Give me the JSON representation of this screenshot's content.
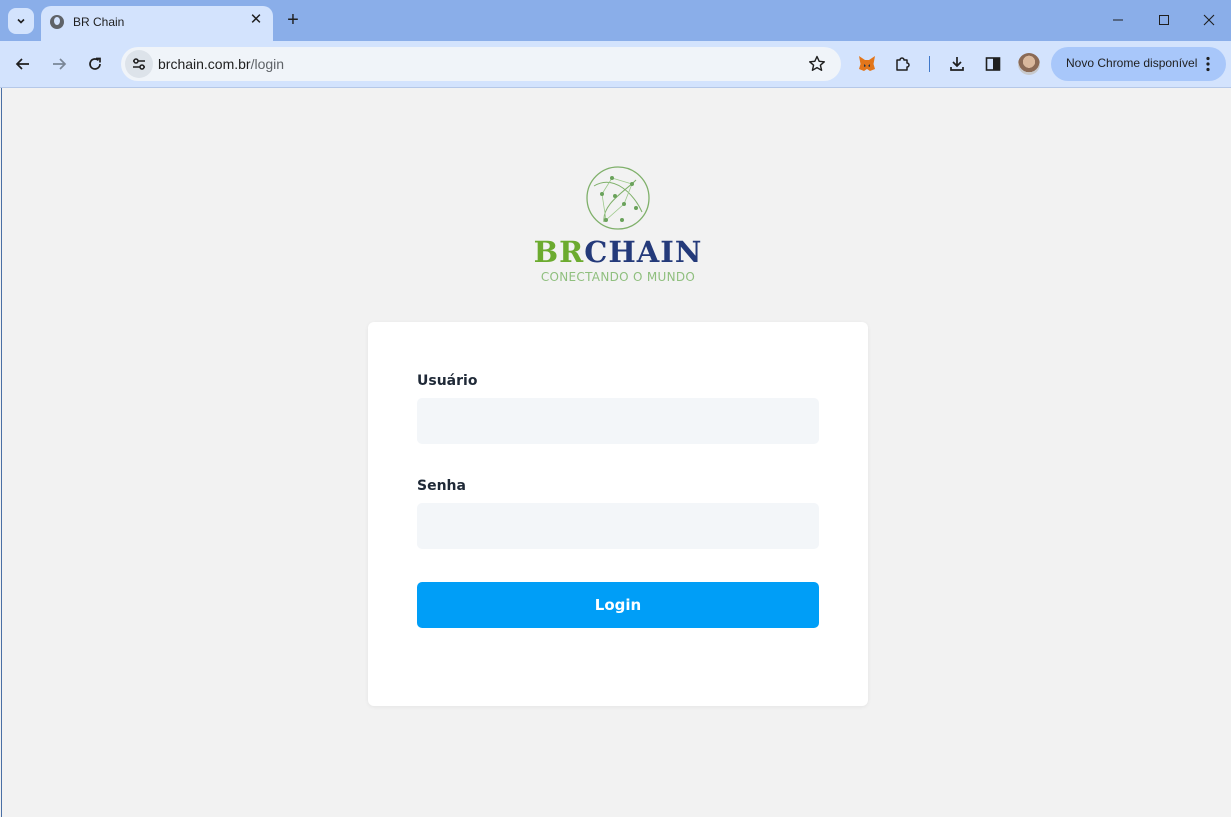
{
  "browser": {
    "tab_title": "BR Chain",
    "url_host": "brchain.com.br",
    "url_path": "/login",
    "update_label": "Novo Chrome disponível",
    "colors": {
      "titlebar": "#8aaee9",
      "toolbar": "#d3e3fd",
      "update_pill": "#a8c7fa"
    }
  },
  "logo": {
    "brand_br": "BR",
    "brand_chain": "CHAIN",
    "tagline": "CONECTANDO O MUNDO",
    "colors": {
      "br": "#6cab2f",
      "chain": "#243a7a",
      "globe": "#7fb06a"
    }
  },
  "form": {
    "user_label": "Usuário",
    "user_value": "",
    "password_label": "Senha",
    "password_value": "",
    "login_label": "Login",
    "colors": {
      "button": "#009ef7",
      "input_bg": "#f3f6f9"
    }
  }
}
